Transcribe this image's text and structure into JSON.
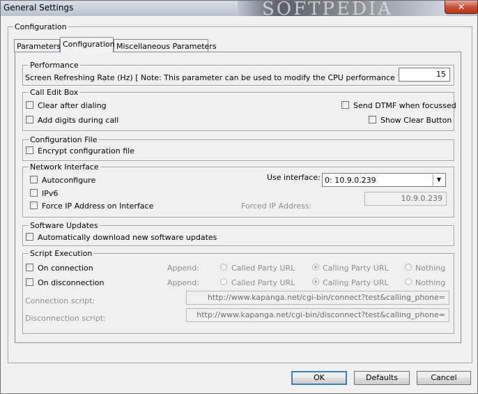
{
  "window": {
    "title": "General Settings",
    "close_label": "✕",
    "watermark": "SOFTPEDIA"
  },
  "outer_group": {
    "label": "Configuration"
  },
  "tabs": [
    {
      "label": "Parameters"
    },
    {
      "label": "Configuration",
      "active": true
    },
    {
      "label": "Miscellaneous Parameters"
    }
  ],
  "performance": {
    "label": "Performance",
    "refresh_label": "Screen Refreshing Rate (Hz) [ Note: This parameter can be used to modify the CPU performance ]:",
    "refresh_value": "15"
  },
  "call_edit_box": {
    "label": "Call Edit Box",
    "clear_after_dialing": "Clear after dialing",
    "add_digits": "Add digits during call",
    "send_dtmf": "Send DTMF when focussed",
    "show_clear": "Show Clear Button"
  },
  "config_file": {
    "label": "Configuration File",
    "encrypt": "Encrypt configuration file"
  },
  "network": {
    "label": "Network Interface",
    "autoconfigure": "Autoconfigure",
    "ipv6": "IPv6",
    "force_ip": "Force IP Address on Interface",
    "use_interface_label": "Use interface:",
    "interface_value": "0: 10.9.0.239",
    "forced_ip_label": "Forced IP Address:",
    "forced_ip_value": "10.9.0.239"
  },
  "software_updates": {
    "label": "Software Updates",
    "auto_download": "Automatically download new software updates"
  },
  "script": {
    "label": "Script Execution",
    "on_connection": "On connection",
    "on_disconnection": "On disconnection",
    "append_label": "Append:",
    "called_party": "Called Party URL",
    "calling_party": "Calling Party URL",
    "nothing": "Nothing",
    "connection_script_label": "Connection script:",
    "connection_script_value": "http://www.kapanga.net/cgi-bin/connect?test&calling_phone=",
    "disconnection_script_label": "Disconnection script:",
    "disconnection_script_value": "http://www.kapanga.net/cgi-bin/disconnect?test&calling_phone="
  },
  "buttons": {
    "ok": "OK",
    "defaults": "Defaults",
    "cancel": "Cancel"
  }
}
